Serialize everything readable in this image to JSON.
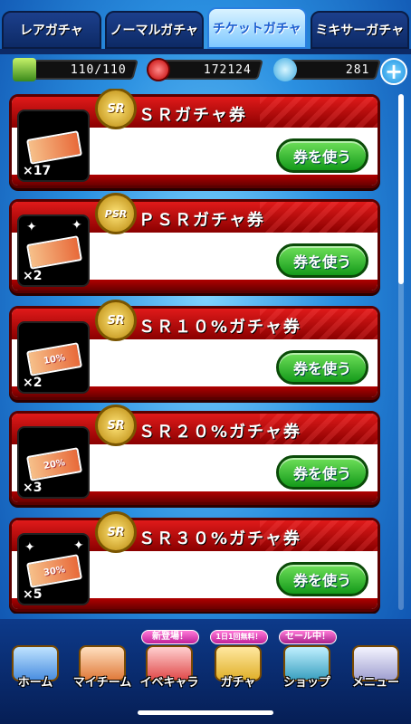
{
  "tabs": [
    {
      "label": "レアガチャ",
      "active": false
    },
    {
      "label": "ノーマルガチャ",
      "active": false
    },
    {
      "label": "チケットガチャ",
      "active": true
    },
    {
      "label": "ミキサーガチャ",
      "active": false
    }
  ],
  "currency": {
    "stamina": "110/110",
    "coins": "172124",
    "gems": "281",
    "add_label": "+"
  },
  "tickets": [
    {
      "badge": "SR",
      "title": "ＳＲガチャ券",
      "count": "×17",
      "ticket_text": "",
      "button": "券を使う"
    },
    {
      "badge": "PSR",
      "title": "ＰＳＲガチャ券",
      "count": "×2",
      "ticket_text": "",
      "button": "券を使う"
    },
    {
      "badge": "SR",
      "title": "ＳＲ１０%ガチャ券",
      "count": "×2",
      "ticket_text": "10%",
      "button": "券を使う"
    },
    {
      "badge": "SR",
      "title": "ＳＲ２０%ガチャ券",
      "count": "×3",
      "ticket_text": "20%",
      "button": "券を使う"
    },
    {
      "badge": "SR",
      "title": "ＳＲ３０%ガチャ券",
      "count": "×5",
      "ticket_text": "30%",
      "button": "券を使う"
    }
  ],
  "nav": [
    {
      "label": "ホーム",
      "tag": ""
    },
    {
      "label": "マイチーム",
      "tag": ""
    },
    {
      "label": "イベキャラ",
      "tag": "新登場！"
    },
    {
      "label": "ガチャ",
      "tag": "1日1回無料！"
    },
    {
      "label": "ショップ",
      "tag": "セール中！"
    },
    {
      "label": "メニュー",
      "tag": ""
    }
  ],
  "colors": {
    "accent_red": "#c00000",
    "button_green": "#1fa51f",
    "tab_active": "#7fc9ff"
  }
}
